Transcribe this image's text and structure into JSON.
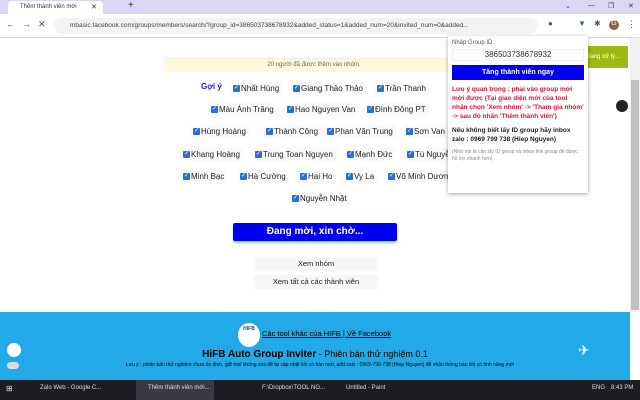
{
  "browser": {
    "tab_title": "Thêm thành viên mới",
    "url": "mbasic.facebook.com/groups/members/search/?group_id=386503738678932&added_status=1&added_num=20&invited_num=0&added..."
  },
  "notice": "20 người đã được thêm vào nhóm.",
  "suggest_label": "Gợi ý",
  "members": [
    "Nhất Hùng",
    "Giang Thảo Thảo",
    "Trần Thanh",
    "Màu Ánh Trăng",
    "Hao Nguyen Van",
    "Đình Đông PT",
    "Hùng Hoàng",
    "Thành Công",
    "Phan Văn Trung",
    "Sơn Van",
    "Khang Hoàng",
    "Trung Toan Nguyen",
    "Mạnh Đức",
    "Tú Nguyễn",
    "Minh Bạc",
    "Hà Cường",
    "Hai Ho",
    "Vy La",
    "Võ Minh Dương",
    "Nguyễn Nhật"
  ],
  "invite_button": "Đang mời, xin chờ...",
  "view_group": "Xem nhóm",
  "view_all_members": "Xem tất cả các thành viên",
  "green_button": "Đang xử lý...",
  "popup": {
    "label": "Nhập Group ID :",
    "group_id": "386503738678932",
    "add_button": "Tăng thành viên ngay",
    "warning": "Lưu ý quan trọng : phải vào group mới mời được (Tại giao diện mới của tool nhấn chọn 'Xem nhóm' -> 'Tham gia nhóm' -> sau đó nhấn 'Thêm thành viên')",
    "contact": "Nếu không biết lấy ID group hãy inbox zalo : 0969 799 738 (Hiep Nguyen)",
    "note": "(Nhớ nói là cần lấy ID group và inbox link group để được hỗ trợ nhanh hơn)"
  },
  "footer": {
    "link1": "Các tool khác của HIFB",
    "link2": "Về Facebook",
    "title": "HiFB Auto Group Inviter",
    "version": " - Phiên bản thử nghiệm 0.1",
    "note": "Lưu ý : phiên bản thử nghiệm chưa ổn định, giữ tool không xóa để tự cập nhật khi có bản mới, add zalo : 0969-799-738 (Hiep Nguyen) để nhận thông báo khi có tính năng mới",
    "logo": "HIFB"
  },
  "taskbar": {
    "items": [
      "Zalo Web - Google C...",
      "Thêm thành viên mới...",
      "F:\\Dropbox\\TOOL NG...",
      "Untitled - Paint"
    ],
    "lang": "ENG",
    "time": "8:43 PM"
  }
}
